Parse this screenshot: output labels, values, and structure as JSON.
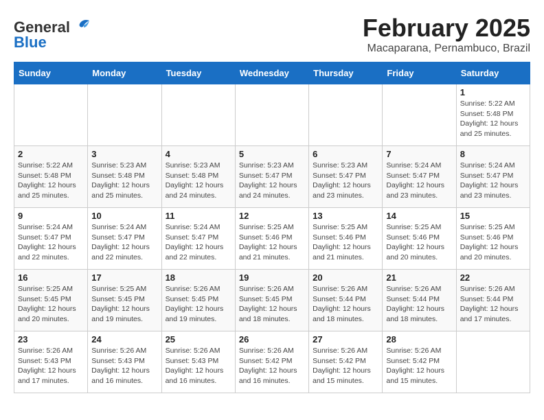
{
  "header": {
    "title": "February 2025",
    "subtitle": "Macaparana, Pernambuco, Brazil",
    "logo_general": "General",
    "logo_blue": "Blue"
  },
  "calendar": {
    "days_of_week": [
      "Sunday",
      "Monday",
      "Tuesday",
      "Wednesday",
      "Thursday",
      "Friday",
      "Saturday"
    ],
    "weeks": [
      [
        {
          "day": "",
          "info": ""
        },
        {
          "day": "",
          "info": ""
        },
        {
          "day": "",
          "info": ""
        },
        {
          "day": "",
          "info": ""
        },
        {
          "day": "",
          "info": ""
        },
        {
          "day": "",
          "info": ""
        },
        {
          "day": "1",
          "info": "Sunrise: 5:22 AM\nSunset: 5:48 PM\nDaylight: 12 hours\nand 25 minutes."
        }
      ],
      [
        {
          "day": "2",
          "info": "Sunrise: 5:22 AM\nSunset: 5:48 PM\nDaylight: 12 hours\nand 25 minutes."
        },
        {
          "day": "3",
          "info": "Sunrise: 5:23 AM\nSunset: 5:48 PM\nDaylight: 12 hours\nand 25 minutes."
        },
        {
          "day": "4",
          "info": "Sunrise: 5:23 AM\nSunset: 5:48 PM\nDaylight: 12 hours\nand 24 minutes."
        },
        {
          "day": "5",
          "info": "Sunrise: 5:23 AM\nSunset: 5:47 PM\nDaylight: 12 hours\nand 24 minutes."
        },
        {
          "day": "6",
          "info": "Sunrise: 5:23 AM\nSunset: 5:47 PM\nDaylight: 12 hours\nand 23 minutes."
        },
        {
          "day": "7",
          "info": "Sunrise: 5:24 AM\nSunset: 5:47 PM\nDaylight: 12 hours\nand 23 minutes."
        },
        {
          "day": "8",
          "info": "Sunrise: 5:24 AM\nSunset: 5:47 PM\nDaylight: 12 hours\nand 23 minutes."
        }
      ],
      [
        {
          "day": "9",
          "info": "Sunrise: 5:24 AM\nSunset: 5:47 PM\nDaylight: 12 hours\nand 22 minutes."
        },
        {
          "day": "10",
          "info": "Sunrise: 5:24 AM\nSunset: 5:47 PM\nDaylight: 12 hours\nand 22 minutes."
        },
        {
          "day": "11",
          "info": "Sunrise: 5:24 AM\nSunset: 5:47 PM\nDaylight: 12 hours\nand 22 minutes."
        },
        {
          "day": "12",
          "info": "Sunrise: 5:25 AM\nSunset: 5:46 PM\nDaylight: 12 hours\nand 21 minutes."
        },
        {
          "day": "13",
          "info": "Sunrise: 5:25 AM\nSunset: 5:46 PM\nDaylight: 12 hours\nand 21 minutes."
        },
        {
          "day": "14",
          "info": "Sunrise: 5:25 AM\nSunset: 5:46 PM\nDaylight: 12 hours\nand 20 minutes."
        },
        {
          "day": "15",
          "info": "Sunrise: 5:25 AM\nSunset: 5:46 PM\nDaylight: 12 hours\nand 20 minutes."
        }
      ],
      [
        {
          "day": "16",
          "info": "Sunrise: 5:25 AM\nSunset: 5:45 PM\nDaylight: 12 hours\nand 20 minutes."
        },
        {
          "day": "17",
          "info": "Sunrise: 5:25 AM\nSunset: 5:45 PM\nDaylight: 12 hours\nand 19 minutes."
        },
        {
          "day": "18",
          "info": "Sunrise: 5:26 AM\nSunset: 5:45 PM\nDaylight: 12 hours\nand 19 minutes."
        },
        {
          "day": "19",
          "info": "Sunrise: 5:26 AM\nSunset: 5:45 PM\nDaylight: 12 hours\nand 18 minutes."
        },
        {
          "day": "20",
          "info": "Sunrise: 5:26 AM\nSunset: 5:44 PM\nDaylight: 12 hours\nand 18 minutes."
        },
        {
          "day": "21",
          "info": "Sunrise: 5:26 AM\nSunset: 5:44 PM\nDaylight: 12 hours\nand 18 minutes."
        },
        {
          "day": "22",
          "info": "Sunrise: 5:26 AM\nSunset: 5:44 PM\nDaylight: 12 hours\nand 17 minutes."
        }
      ],
      [
        {
          "day": "23",
          "info": "Sunrise: 5:26 AM\nSunset: 5:43 PM\nDaylight: 12 hours\nand 17 minutes."
        },
        {
          "day": "24",
          "info": "Sunrise: 5:26 AM\nSunset: 5:43 PM\nDaylight: 12 hours\nand 16 minutes."
        },
        {
          "day": "25",
          "info": "Sunrise: 5:26 AM\nSunset: 5:43 PM\nDaylight: 12 hours\nand 16 minutes."
        },
        {
          "day": "26",
          "info": "Sunrise: 5:26 AM\nSunset: 5:42 PM\nDaylight: 12 hours\nand 16 minutes."
        },
        {
          "day": "27",
          "info": "Sunrise: 5:26 AM\nSunset: 5:42 PM\nDaylight: 12 hours\nand 15 minutes."
        },
        {
          "day": "28",
          "info": "Sunrise: 5:26 AM\nSunset: 5:42 PM\nDaylight: 12 hours\nand 15 minutes."
        },
        {
          "day": "",
          "info": ""
        }
      ]
    ]
  }
}
